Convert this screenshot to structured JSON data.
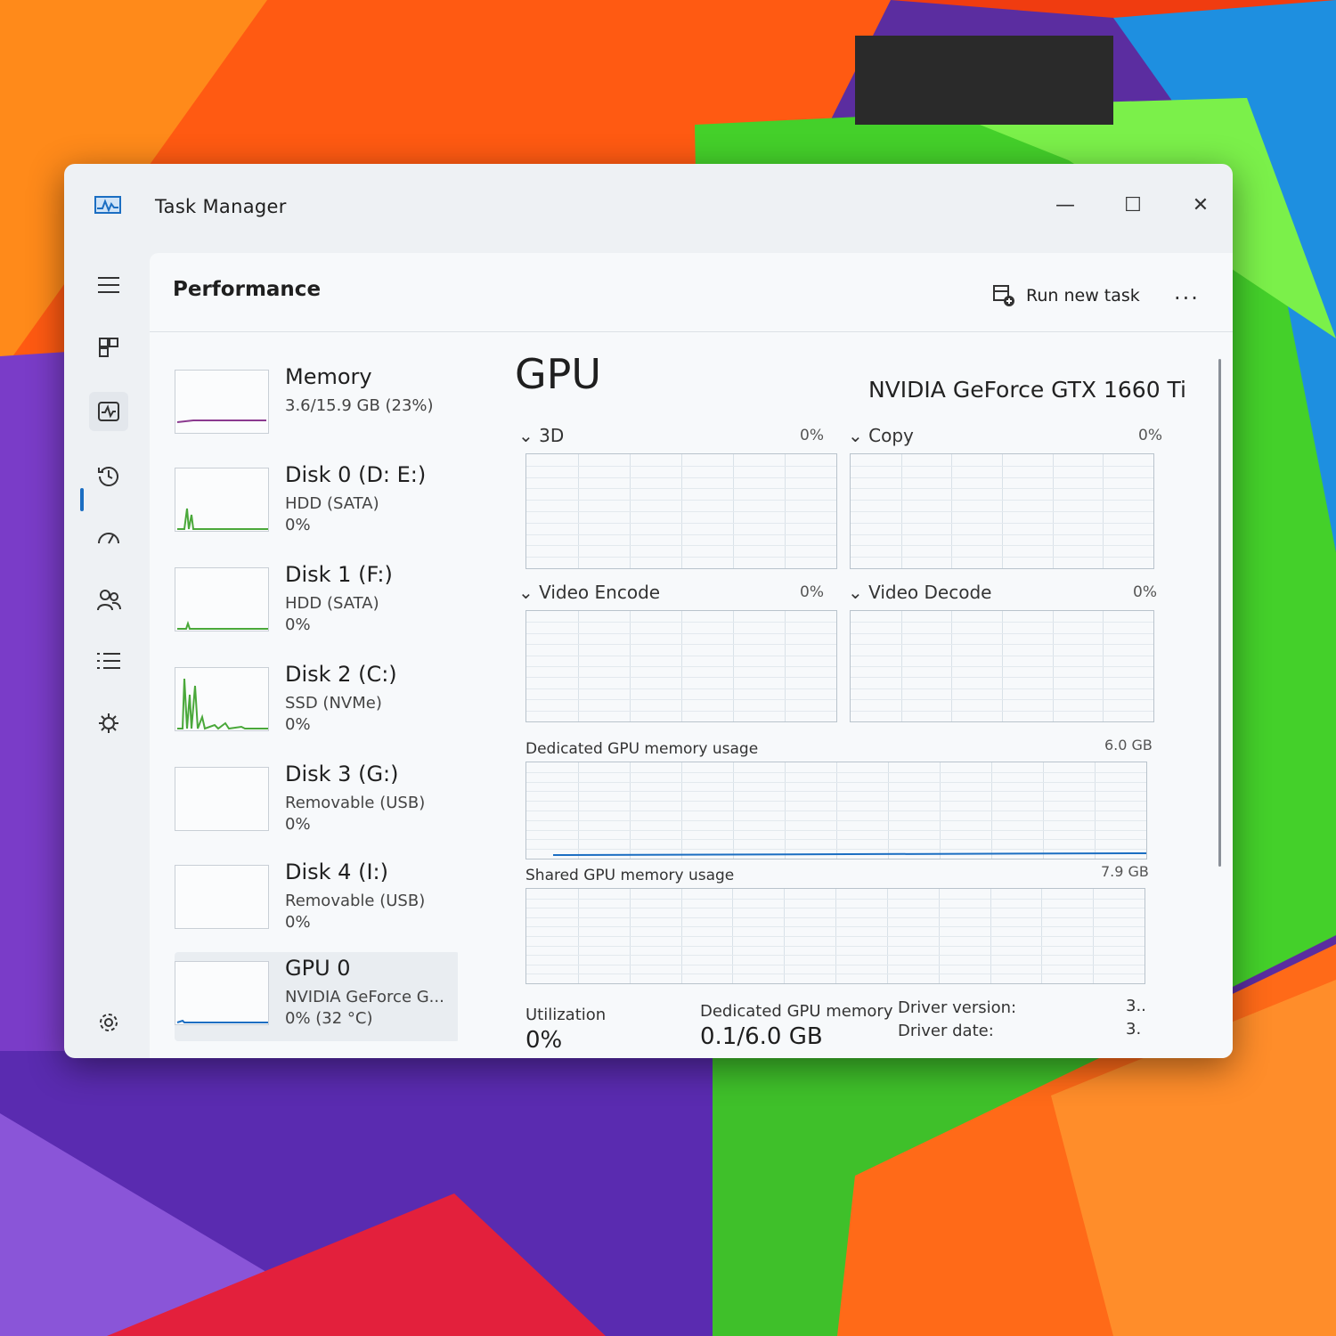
{
  "window": {
    "title": "Task Manager"
  },
  "window_controls": {
    "minimize": "—",
    "maximize": "☐",
    "close": "✕"
  },
  "nav": {
    "items": [
      {
        "icon": "hamburger-menu-icon"
      },
      {
        "icon": "processes-icon"
      },
      {
        "icon": "performance-icon",
        "active": true
      },
      {
        "icon": "app-history-icon"
      },
      {
        "icon": "startup-apps-icon"
      },
      {
        "icon": "users-icon"
      },
      {
        "icon": "details-icon"
      },
      {
        "icon": "services-icon"
      },
      {
        "icon": "settings-icon"
      }
    ]
  },
  "header": {
    "title": "Performance",
    "run_new_task": "Run new task",
    "more": "..."
  },
  "resources": [
    {
      "name": "Memory",
      "sub": "3.6/15.9 GB (23%)",
      "value": ""
    },
    {
      "name": "Disk 0 (D: E:)",
      "sub": "HDD (SATA)",
      "value": "0%"
    },
    {
      "name": "Disk 1 (F:)",
      "sub": "HDD (SATA)",
      "value": "0%"
    },
    {
      "name": "Disk 2 (C:)",
      "sub": "SSD (NVMe)",
      "value": "0%"
    },
    {
      "name": "Disk 3 (G:)",
      "sub": "Removable (USB)",
      "value": "0%"
    },
    {
      "name": "Disk 4 (I:)",
      "sub": "Removable (USB)",
      "value": "0%"
    },
    {
      "name": "GPU 0",
      "sub": "NVIDIA GeForce G...",
      "value": "0% (32 °C)",
      "selected": true
    }
  ],
  "gpu": {
    "title": "GPU",
    "model": "NVIDIA GeForce GTX 1660 Ti",
    "engines": [
      {
        "label": "3D",
        "percent": "0%"
      },
      {
        "label": "Copy",
        "percent": "0%"
      },
      {
        "label": "Video Encode",
        "percent": "0%"
      },
      {
        "label": "Video Decode",
        "percent": "0%"
      }
    ],
    "dedicated_label": "Dedicated GPU memory usage",
    "dedicated_max": "6.0 GB",
    "shared_label": "Shared GPU memory usage",
    "shared_max": "7.9 GB",
    "stats": {
      "utilization_label": "Utilization",
      "utilization_value": "0%",
      "dedicated_label": "Dedicated GPU memory",
      "dedicated_value": "0.1/6.0 GB",
      "driver_version_label": "Driver version:",
      "driver_version_value": "3..",
      "driver_date_label": "Driver date:",
      "driver_date_value": "3."
    }
  },
  "colors": {
    "memory_graph": "#8b3a8f",
    "disk_graph": "#4aa83a",
    "gpu_graph": "#1b6ec2",
    "accent": "#1b6ec2"
  }
}
